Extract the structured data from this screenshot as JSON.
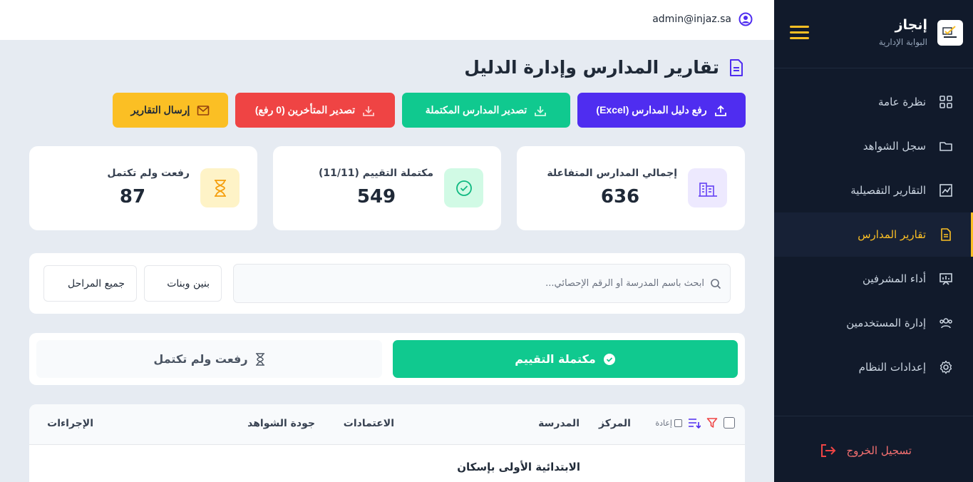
{
  "sidebar": {
    "brand_name": "إنجاز",
    "brand_subtitle": "البوابة الإدارية",
    "items": [
      {
        "label": "نظرة عامة",
        "icon": "grid-icon"
      },
      {
        "label": "سجل الشواهد",
        "icon": "folder-icon"
      },
      {
        "label": "التقارير التفصيلية",
        "icon": "chart-line-icon"
      },
      {
        "label": "تقارير المدارس",
        "icon": "document-icon",
        "active": true
      },
      {
        "label": "أداء المشرفين",
        "icon": "presentation-icon"
      },
      {
        "label": "إدارة المستخدمين",
        "icon": "users-icon"
      },
      {
        "label": "إعدادات النظام",
        "icon": "gear-icon"
      }
    ],
    "logout_label": "تسجيل الخروج",
    "active_color": "#fbbf24"
  },
  "topbar": {
    "user_email": "admin@injaz.sa"
  },
  "page": {
    "title": "تقارير المدارس وإدارة الدليل"
  },
  "actions": {
    "upload_label": "رفع دليل المدارس (Excel)",
    "export_complete_label": "تصدير المدارس المكتملة",
    "export_late_label": "تصدير المتأخرين (0 رفع)",
    "send_reports_label": "إرسال التقارير"
  },
  "stats": [
    {
      "label": "إجمالي المدارس المتفاعلة",
      "value": "636",
      "icon": "building-icon",
      "color": "#6d4cf5"
    },
    {
      "label": "مكتملة التقييم (11/11)",
      "value": "549",
      "icon": "check-circle-icon",
      "color": "#10c98f"
    },
    {
      "label": "رفعت ولم تكتمل",
      "value": "87",
      "icon": "hourglass-icon",
      "color": "#f59e0b"
    }
  ],
  "filters": {
    "search_placeholder": "ابحث باسم المدرسة أو الرقم الإحصائي...",
    "gender_value": "بنين وبنات",
    "stage_value": "جميع المراحل"
  },
  "tabs": {
    "complete_label": "مكتملة التقييم",
    "late_label": "رفعت ولم تكتمل"
  },
  "table": {
    "reset_label": "إعادة",
    "headers": {
      "center": "المركز",
      "school": "المدرسة",
      "accreditations": "الاعتمادات",
      "evidence_quality": "جودة الشواهد",
      "actions": "الإجراءات"
    },
    "rows": [
      {
        "school": "الابتدائية الأولى بإسكان"
      }
    ]
  }
}
